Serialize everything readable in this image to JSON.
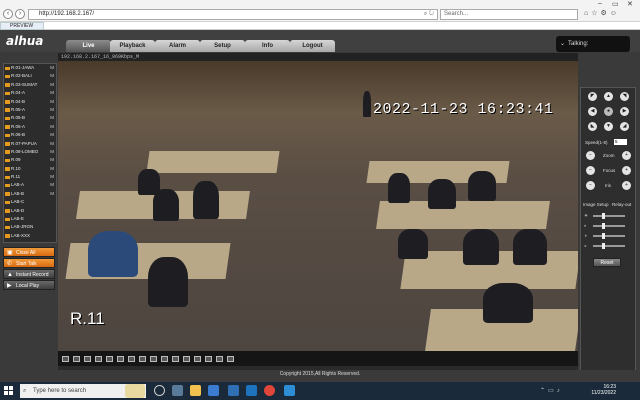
{
  "browser": {
    "address": "http://192.168.2.167/",
    "search_placeholder": "Search...",
    "tab_title": "PREVIEW"
  },
  "app": {
    "logo": "alhua",
    "tabs": [
      "Live",
      "Playback",
      "Alarm",
      "Setup",
      "Info",
      "Logout"
    ],
    "active_tab": "Live",
    "talking_label": "Talking"
  },
  "devices": [
    {
      "label": "R.01-JAWA",
      "mark": "M"
    },
    {
      "label": "R.02-BALI",
      "mark": "M"
    },
    {
      "label": "R.03-SUMAT",
      "mark": "M"
    },
    {
      "label": "R.04-A",
      "mark": "M"
    },
    {
      "label": "R.04-B",
      "mark": "M"
    },
    {
      "label": "R.05-A",
      "mark": "M"
    },
    {
      "label": "R.05-B",
      "mark": "M"
    },
    {
      "label": "R.06-A",
      "mark": "M"
    },
    {
      "label": "R.06-B",
      "mark": "M"
    },
    {
      "label": "R.07-PAPUA",
      "mark": "M"
    },
    {
      "label": "R.08-LOMBO",
      "mark": "M"
    },
    {
      "label": "R.09",
      "mark": "M"
    },
    {
      "label": "R.10",
      "mark": "M"
    },
    {
      "label": "R.11",
      "mark": "M"
    },
    {
      "label": "LAB-A",
      "mark": "M"
    },
    {
      "label": "LAB-B",
      "mark": "M"
    },
    {
      "label": "LAB-C",
      "mark": ""
    },
    {
      "label": "LAB-D",
      "mark": ""
    },
    {
      "label": "LAB-E",
      "mark": ""
    },
    {
      "label": "LAB-JRGN",
      "mark": ""
    },
    {
      "label": "LAB-XXX",
      "mark": ""
    }
  ],
  "side_buttons": [
    "Close All",
    "Start Talk",
    "Instant Record",
    "Local Play"
  ],
  "video": {
    "title": "192.168.2.167_16_969Kbps_M",
    "timestamp": "2022-11-23 16:23:41",
    "camera_label": "R.11"
  },
  "ptz": {
    "speed_label": "Speed(1-8)",
    "speed_value": "5",
    "zoom_label": "Zoom",
    "focus_label": "Focus",
    "iris_label": "Iris",
    "image_setup_label": "Image Setup",
    "relay_out_label": "Relay-out",
    "reset_label": "Reset"
  },
  "footer": "Copyright 2015,All Rights Reserved.",
  "taskbar": {
    "search_placeholder": "Type here to search",
    "time": "16:23",
    "date": "11/23/2022"
  }
}
